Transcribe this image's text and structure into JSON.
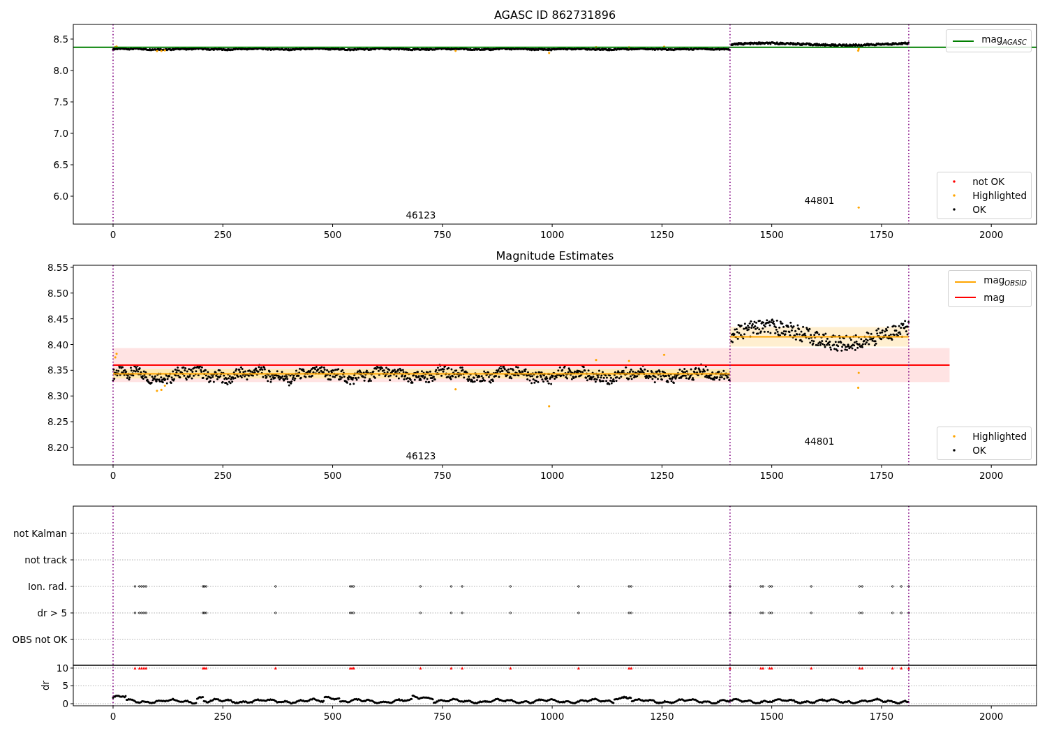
{
  "panels": [
    {
      "kind": "magnitude",
      "chart_data": {
        "type": "line",
        "title": "AGASC ID 862731896",
        "xlim": [
          -90.6,
          2103
        ],
        "ylim": [
          5.556,
          8.733
        ],
        "xticks": [
          0,
          250,
          500,
          750,
          1000,
          1250,
          1500,
          1750,
          2000
        ],
        "yticks": [
          {
            "value": 6,
            "label": "6.0"
          },
          {
            "value": 6.5,
            "label": "6.5"
          },
          {
            "value": 7,
            "label": "7.0"
          },
          {
            "value": 7.5,
            "label": "7.5"
          },
          {
            "value": 8,
            "label": "8.0"
          },
          {
            "value": 8.5,
            "label": "8.5"
          }
        ],
        "series": [
          {
            "name": "mag$_{AGASC}$",
            "color": "#008000",
            "x": [
              -90.6,
              2103
            ],
            "values": [
              8.37,
              8.37
            ]
          }
        ],
        "ref_lines": [
          {
            "axis": "x",
            "value": 0,
            "color": "#800080"
          },
          {
            "axis": "x",
            "value": 1405,
            "color": "#800080"
          },
          {
            "axis": "x",
            "value": 1812,
            "color": "#800080"
          }
        ],
        "annotations": [
          "46123",
          "44801"
        ]
      },
      "point_legend": [
        {
          "label": "not OK",
          "color": "#ff0000"
        },
        {
          "label": "Highlighted",
          "color": "#ffa500"
        },
        {
          "label": "OK",
          "color": "#000000"
        }
      ]
    },
    {
      "kind": "magnitude",
      "chart_data": {
        "type": "line",
        "title": "Magnitude Estimates",
        "xlim": [
          -90.6,
          2103
        ],
        "ylim": [
          8.166,
          8.554
        ],
        "xticks": [
          0,
          250,
          500,
          750,
          1000,
          1250,
          1500,
          1750,
          2000
        ],
        "yticks": [
          {
            "value": 8.2,
            "label": "8.20"
          },
          {
            "value": 8.25,
            "label": "8.25"
          },
          {
            "value": 8.3,
            "label": "8.30"
          },
          {
            "value": 8.35,
            "label": "8.35"
          },
          {
            "value": 8.4,
            "label": "8.40"
          },
          {
            "value": 8.45,
            "label": "8.45"
          },
          {
            "value": 8.5,
            "label": "8.50"
          },
          {
            "value": 8.55,
            "label": "8.55"
          }
        ],
        "series": [
          {
            "name": "mag$_{OBSID}$",
            "color": "#ffa500",
            "x": [
              0,
              1405,
              null,
              1405,
              1812
            ],
            "values": [
              8.343,
              8.343,
              null,
              8.415,
              8.415
            ]
          },
          {
            "name": "mag",
            "color": "#ff0000",
            "x": [
              0,
              1905
            ],
            "values": [
              8.36,
              8.36
            ]
          }
        ],
        "bands": [
          {
            "axis": "y",
            "from": 8.327,
            "to": 8.393,
            "color": "#ffe3e3"
          },
          {
            "axis": "y",
            "from": 8.334,
            "to": 8.352,
            "color": "#ffe9b0"
          },
          {
            "axis": "y",
            "from": 8.396,
            "to": 8.434,
            "color": "#ffefd0"
          }
        ],
        "ref_lines": [
          {
            "axis": "x",
            "value": 0,
            "color": "#800080"
          },
          {
            "axis": "x",
            "value": 1405,
            "color": "#800080"
          },
          {
            "axis": "x",
            "value": 1812,
            "color": "#800080"
          }
        ],
        "annotations": [
          "46123",
          "44801"
        ]
      },
      "point_legend": [
        {
          "label": "Highlighted",
          "color": "#ffa500"
        },
        {
          "label": "OK",
          "color": "#000000"
        }
      ]
    },
    {
      "kind": "flags",
      "flags": [
        "not Kalman",
        "not track",
        "Ion. rad.",
        "dr > 5",
        "OBS not OK"
      ],
      "chart_data": {
        "type": "scatter",
        "ylabel": "dr",
        "xlim": [
          -90.6,
          2103
        ],
        "ylim": [
          -0.59,
          10.78
        ],
        "xticks": [
          0,
          250,
          500,
          750,
          1000,
          1250,
          1500,
          1750,
          2000
        ],
        "yticks": [
          0,
          5,
          10
        ],
        "grid": true,
        "ref_lines": [
          {
            "axis": "x",
            "value": 0,
            "color": "#800080"
          },
          {
            "axis": "x",
            "value": 1405,
            "color": "#800080"
          },
          {
            "axis": "x",
            "value": 1812,
            "color": "#800080"
          }
        ]
      }
    }
  ]
}
